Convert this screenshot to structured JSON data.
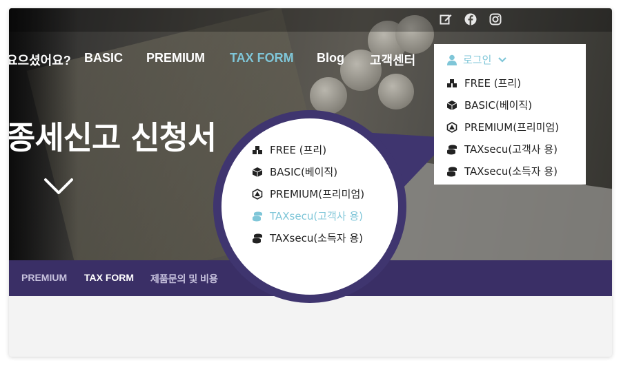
{
  "social": {
    "icons": [
      "edit-icon",
      "facebook-icon",
      "instagram-icon"
    ]
  },
  "nav": {
    "items": [
      "요으셨어요?",
      "BASIC",
      "PREMIUM",
      "TAX FORM",
      "Blog",
      "고객센터"
    ],
    "active": "TAX FORM"
  },
  "hero": {
    "headline": "종세신고 신청서"
  },
  "login": {
    "label": "로그인"
  },
  "dropdown": {
    "items": [
      {
        "label": "FREE (프리)",
        "icon": "cubes-icon"
      },
      {
        "label": "BASIC(베이직)",
        "icon": "cube-icon"
      },
      {
        "label": "PREMIUM(프리미엄)",
        "icon": "dice-d20-icon"
      },
      {
        "label": "TAXsecu(고객사 용)",
        "icon": "coins-icon"
      },
      {
        "label": "TAXsecu(소득자 용)",
        "icon": "coins-icon"
      }
    ]
  },
  "zoom": {
    "items": [
      {
        "label": "FREE (프리)",
        "icon": "cubes-icon"
      },
      {
        "label": "BASIC(베이직)",
        "icon": "cube-icon"
      },
      {
        "label": "PREMIUM(프리미엄)",
        "icon": "dice-d20-icon"
      },
      {
        "label": "TAXsecu(고객사 용)",
        "icon": "coins-icon",
        "highlighted": true
      },
      {
        "label": "TAXsecu(소득자 용)",
        "icon": "coins-icon"
      }
    ]
  },
  "subnav": {
    "items": [
      "PREMIUM",
      "TAX FORM",
      "제품문의 및 비용"
    ],
    "current": "TAX FORM"
  },
  "colors": {
    "accent": "#7fc6d8",
    "brand": "#3a2f66",
    "zoom_ring": "#3f356f"
  }
}
